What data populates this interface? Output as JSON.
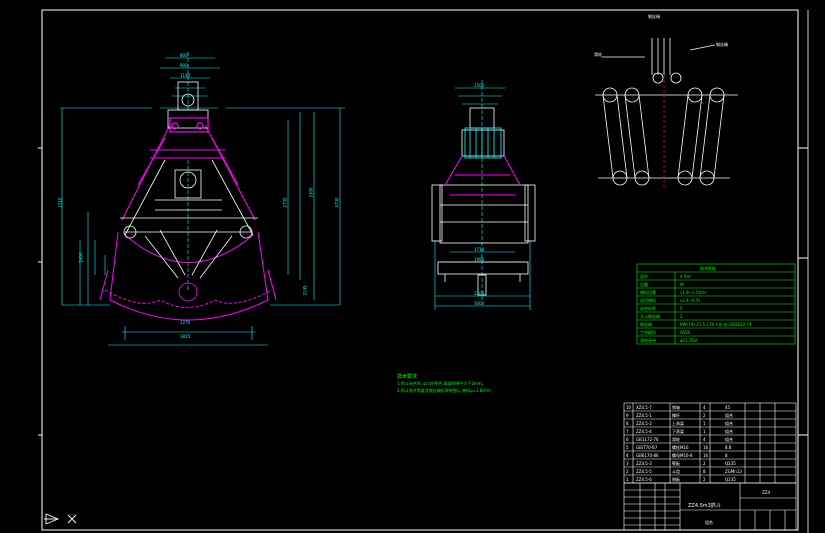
{
  "colors": {
    "background": "#000000",
    "frame": "#ffffff",
    "dims": "#00ffff",
    "outline": "#ffffff",
    "body": "#ff00ff",
    "text": "#00ff00",
    "table": "#00ff00"
  },
  "rope_diagram": {
    "top_label": "钢丝绳",
    "left_label": "滑轮",
    "right_label": "钢丝绳"
  },
  "spec_table": {
    "title": "技术性能",
    "rows": [
      {
        "key": "容积",
        "value": "4.5m³"
      },
      {
        "key": "自重",
        "value": "6t"
      },
      {
        "key": "物料比重",
        "value": "γ1.8~2.5t/m³"
      },
      {
        "key": "适用物料",
        "value": "γ2.4~6.5t"
      },
      {
        "key": "闭合倍率",
        "value": "5"
      },
      {
        "key": "开斗钢丝绳",
        "value": "2"
      },
      {
        "key": "闭合钢丝绳",
        "value": "2"
      },
      {
        "key": "钢丝绳",
        "value": "6W(19)-21.5-170-I-光-右-GB1102-74"
      },
      {
        "key": "工作级别",
        "value": "A500"
      },
      {
        "key": "滑轮直径",
        "value": "φ15.35st"
      }
    ]
  },
  "notes": {
    "title": "技术要求",
    "lines": [
      "1.抓斗闭合时,斗口应密合,局部间隙不大于2mm。",
      "2.抓斗张开角度及钢丝绳倍率按图示,装料ρ=1.8t/m³。"
    ]
  },
  "parts_list": {
    "rows": [
      [
        "10",
        "XZ4.5-7",
        "销轴",
        "4",
        "45",
        "4.2",
        "16.8"
      ],
      [
        "9",
        "ZZ4.5-1",
        "撑杆",
        "2",
        "组合",
        "425",
        "850"
      ],
      [
        "8",
        "ZZ4.5-2",
        "上承梁",
        "1",
        "组合",
        "1120",
        "1120"
      ],
      [
        "7",
        "ZZ4.5-4",
        "下承梁",
        "1",
        "组合",
        "1480",
        "1480"
      ],
      [
        "6",
        "GB1172-76",
        "滑轮",
        "4",
        "组合",
        "0.6",
        "2.4"
      ],
      [
        "5",
        "GB/T70-87",
        "螺栓M16",
        "16",
        "8.8",
        "0.1",
        "1.6"
      ],
      [
        "4",
        "GB6170-86",
        "螺母M16-8",
        "16",
        "8",
        "0.03",
        "0.5"
      ],
      [
        "3",
        "ZZ4.5-3",
        "颚板",
        "2",
        "Q235",
        "2.2",
        "4.4"
      ],
      [
        "2",
        "ZZ4.5-5",
        "斗齿",
        "8",
        "ZGMn13",
        "3",
        "24"
      ],
      [
        "1",
        "ZZ4.5-6",
        "侧板",
        "2",
        "Q235",
        "5.7",
        "11.4"
      ]
    ]
  },
  "title_block": {
    "drawing_name": "ZZ4.5m3抓斗",
    "drawing_no": "ZZ4",
    "scale": "1:20",
    "material": "组合"
  },
  "views": {
    "front_dims": [
      "800",
      "900",
      "1140",
      "2110",
      "2735",
      "3300",
      "4730",
      "3300",
      "1640",
      "2210",
      "2270",
      "3815",
      "2400",
      "3145"
    ],
    "side_dims": [
      "1500",
      "1710",
      "1990",
      "2200",
      "3000"
    ]
  },
  "ucs": {
    "x_label": "X"
  }
}
